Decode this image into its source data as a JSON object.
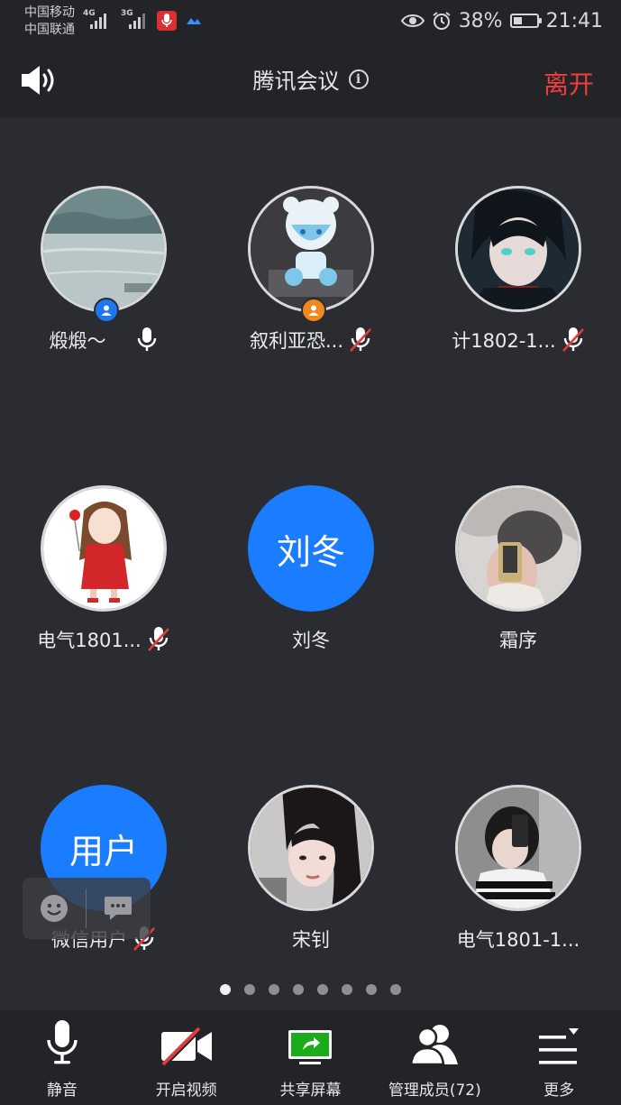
{
  "status_bar": {
    "carrier_1": "中国移动",
    "carrier_2": "中国联通",
    "net_1": "4G",
    "net_2": "3G",
    "battery": "38%",
    "battery_level": 0.38,
    "time": "21:41"
  },
  "header": {
    "title": "腾讯会议",
    "leave_label": "离开"
  },
  "participants": [
    {
      "name": "煅煅～",
      "mic": "on",
      "badge": "blue"
    },
    {
      "name": "叙利亚恐...",
      "mic": "muted",
      "badge": "orange"
    },
    {
      "name": "计1802-1...",
      "mic": "muted"
    },
    {
      "name": "电气1801...",
      "mic": "muted"
    },
    {
      "name": "刘冬",
      "avatar_text": "刘冬",
      "mic": "none"
    },
    {
      "name": "霜序",
      "mic": "none"
    },
    {
      "name": "微信用户",
      "avatar_text": "用户",
      "mic": "muted"
    },
    {
      "name": "宋钊",
      "mic": "none"
    },
    {
      "name": "电气1801-1...",
      "mic": "none"
    }
  ],
  "pager": {
    "count": 8,
    "active": 0
  },
  "toolbar": {
    "mute": "静音",
    "video": "开启视频",
    "share": "共享屏幕",
    "members": "管理成员(72)",
    "more": "更多"
  },
  "colors": {
    "accent_blue": "#1a7cff",
    "leave_red": "#ef3d3d",
    "mute_red": "#e53a3a",
    "share_green": "#1aad19"
  }
}
